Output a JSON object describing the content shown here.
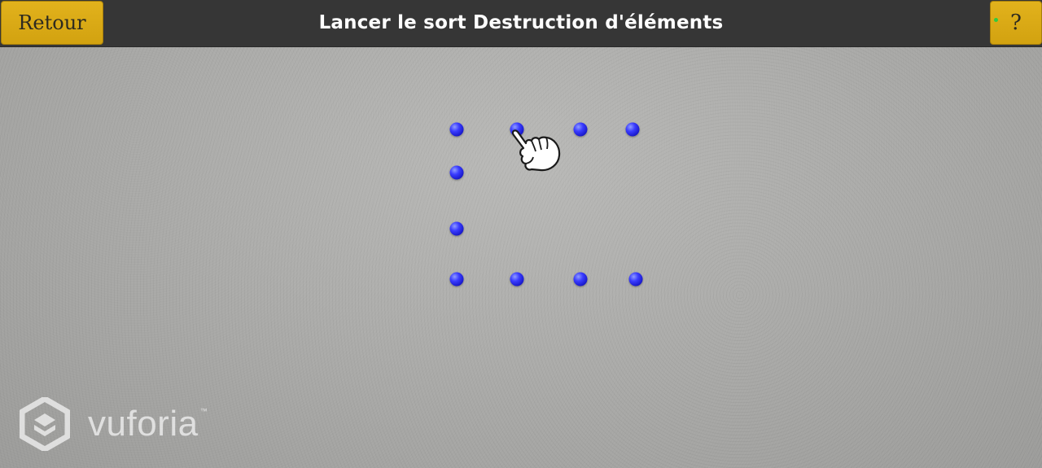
{
  "header": {
    "back_label": "Retour",
    "title": "Lancer le sort Destruction d'éléments",
    "help_label": "?",
    "button_color": "#d9a914",
    "bar_color": "#363636"
  },
  "pattern": {
    "dot_color": "#2020d8",
    "hand_icon": "pointing-hand-icon"
  },
  "watermark": {
    "brand": "vuforia",
    "trademark": "™",
    "logo_icon": "vuforia-cube-icon"
  }
}
